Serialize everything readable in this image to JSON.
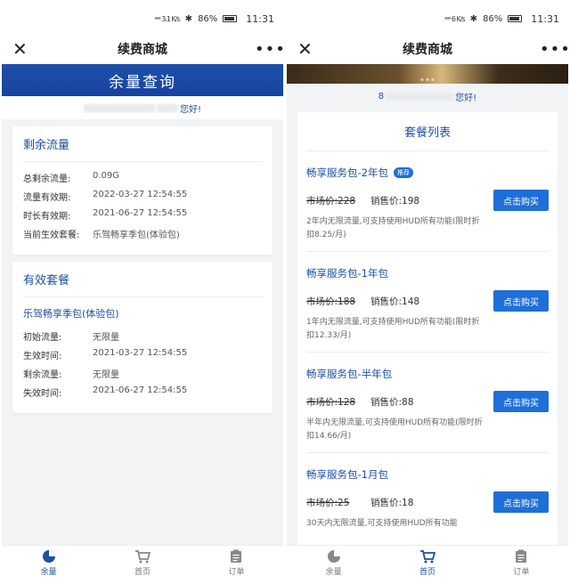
{
  "status_bar": {
    "signal": "ᵃᵃᵃ 3.1 K/s",
    "signal_right": "ᵃᵃᵃ 6 K/s",
    "battery": "86%",
    "time": "11:31"
  },
  "nav": {
    "title": "续费商城",
    "close": "✕",
    "more": "•••"
  },
  "left": {
    "banner": "余量查询",
    "greeting_suffix": "您好!",
    "remaining": {
      "title": "剩余流量",
      "rows": [
        {
          "k": "总剩余流量:",
          "v": "0.09G"
        },
        {
          "k": "流量有效期:",
          "v": "2022-03-27 12:54:55"
        },
        {
          "k": "时长有效期:",
          "v": "2021-06-27 12:54:55"
        },
        {
          "k": "当前生效套餐:",
          "v": "乐驾畅享季包(体验包)"
        }
      ]
    },
    "active": {
      "title": "有效套餐",
      "package_name": "乐驾畅享季包(体验包)",
      "rows": [
        {
          "k": "初始流量:",
          "v": "无限量"
        },
        {
          "k": "生效时间:",
          "v": "2021-03-27 12:54:55"
        },
        {
          "k": "剩余流量:",
          "v": "无限量"
        },
        {
          "k": "失效时间:",
          "v": "2021-06-27 12:54:55"
        }
      ]
    }
  },
  "right": {
    "greeting_prefix": "8",
    "greeting_suffix": "您好!",
    "list_title": "套餐列表",
    "buy_label": "点击购买",
    "badge": "推荐",
    "packages": [
      {
        "name": "畅享服务包-2年包",
        "market": "市场价:228",
        "sale": "销售价:198",
        "desc": "2年内无限流量,可支持使用HUD所有功能(限时折扣8.25/月)"
      },
      {
        "name": "畅享服务包-1年包",
        "market": "市场价:188",
        "sale": "销售价:148",
        "desc": "1年内无限流量,可支持使用HUD所有功能(限时折扣12.33/月)"
      },
      {
        "name": "畅享服务包-半年包",
        "market": "市场价:128",
        "sale": "销售价:88",
        "desc": "半年内无限流量,可支持使用HUD所有功能(限时折扣14.66/月)"
      },
      {
        "name": "畅享服务包-1月包",
        "market": "市场价:25",
        "sale": "销售价:18",
        "desc": "30天内无限流量,可支持使用HUD所有功能"
      }
    ]
  },
  "tabs": [
    {
      "label": "余量",
      "icon": "pie-chart-icon"
    },
    {
      "label": "首页",
      "icon": "cart-icon"
    },
    {
      "label": "订单",
      "icon": "clipboard-icon"
    }
  ],
  "colors": {
    "accent": "#1e50a2",
    "button": "#1e6fd8",
    "banner": "#1743a0"
  }
}
